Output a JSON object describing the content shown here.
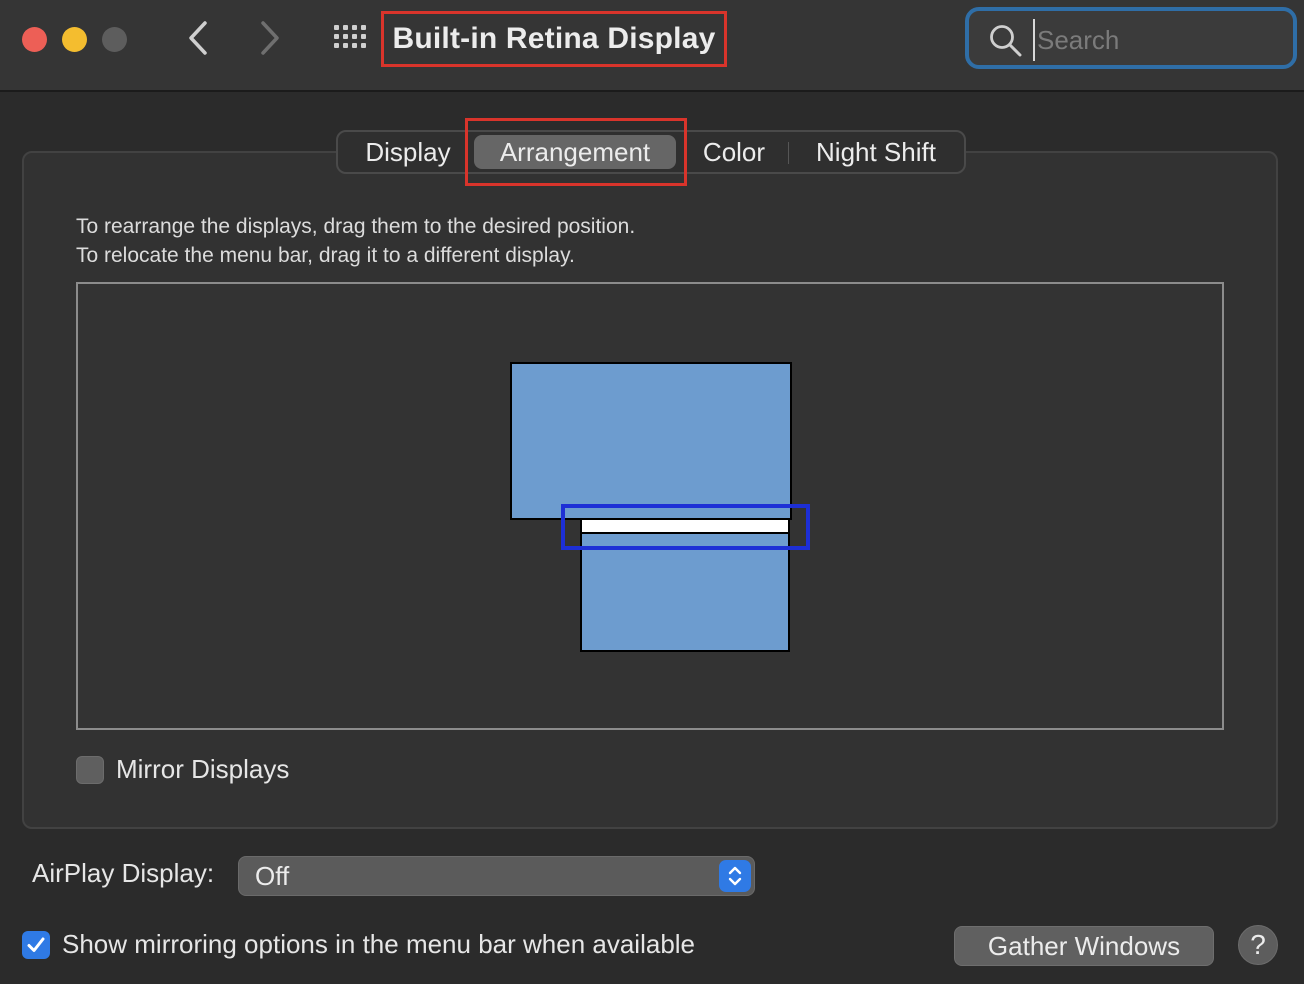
{
  "window": {
    "title": "Built-in Retina Display"
  },
  "toolbar": {
    "back_icon": "chevron-left-icon",
    "forward_icon": "chevron-right-icon",
    "show_all_icon": "grid-icon"
  },
  "search": {
    "value": "",
    "placeholder": "Search",
    "icon": "search-icon"
  },
  "tabs": [
    {
      "label": "Display",
      "selected": false
    },
    {
      "label": "Arrangement",
      "selected": true
    },
    {
      "label": "Color",
      "selected": false
    },
    {
      "label": "Night Shift",
      "selected": false
    }
  ],
  "arrangement": {
    "instruction_line1": "To rearrange the displays, drag them to the desired position.",
    "instruction_line2": "To relocate the menu bar, drag it to a different display."
  },
  "mirror_displays": {
    "label": "Mirror Displays",
    "checked": false
  },
  "airplay": {
    "label": "AirPlay Display:",
    "selected_value": "Off"
  },
  "show_mirroring": {
    "label": "Show mirroring options in the menu bar when available",
    "checked": true
  },
  "buttons": {
    "gather_windows": "Gather Windows",
    "help": "?"
  },
  "colors": {
    "accent_blue": "#2f7ae5",
    "display_fill": "#6d9ccf",
    "annotation_red": "#d9342b",
    "annotation_blue": "#1d2fd6"
  }
}
